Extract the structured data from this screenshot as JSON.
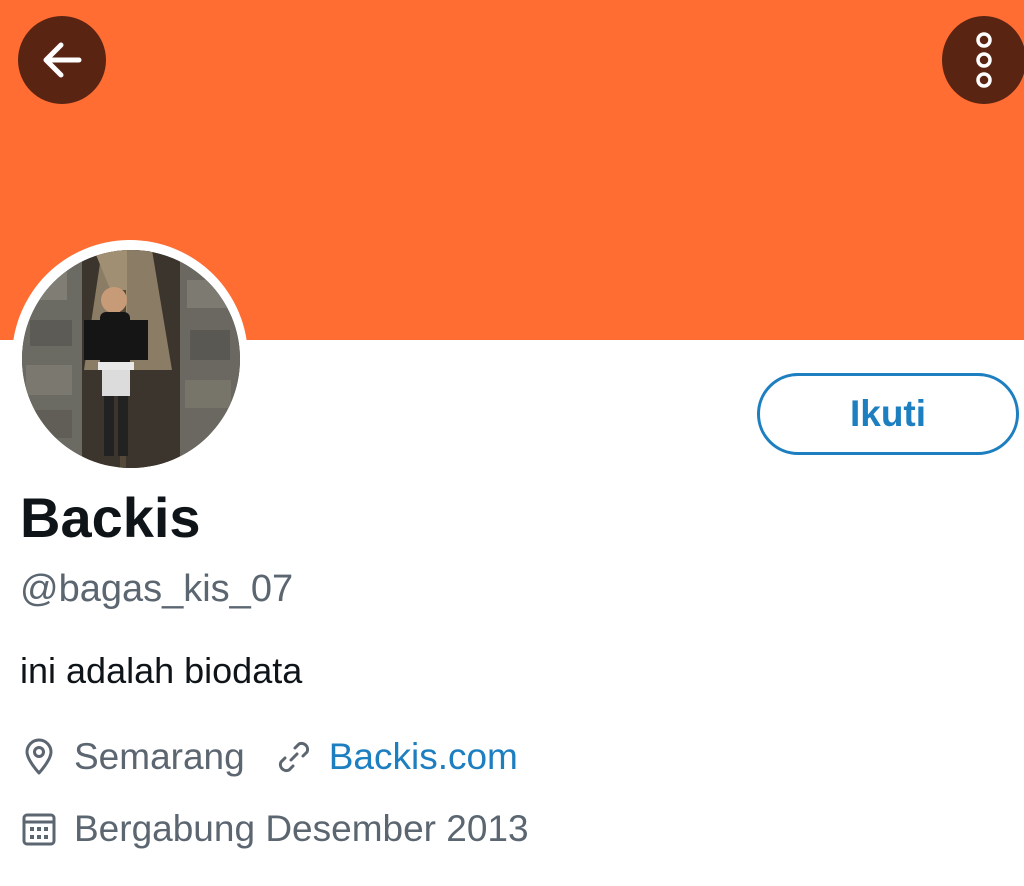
{
  "header": {
    "back_icon": "arrow-left-icon",
    "more_icon": "more-vertical-icon",
    "banner_color": "#ff6d33",
    "button_color": "#5a2412"
  },
  "profile": {
    "display_name": "Backis",
    "handle": "@bagas_kis_07",
    "bio": "ini adalah biodata",
    "location": "Semarang",
    "website": "Backis.com",
    "joined": "Bergabung Desember 2013",
    "avatar": "profile-photo",
    "follow_label": "Ikuti"
  },
  "colors": {
    "accent": "#1d7fc0",
    "text_primary": "#0f1419",
    "text_secondary": "#5b6671"
  }
}
